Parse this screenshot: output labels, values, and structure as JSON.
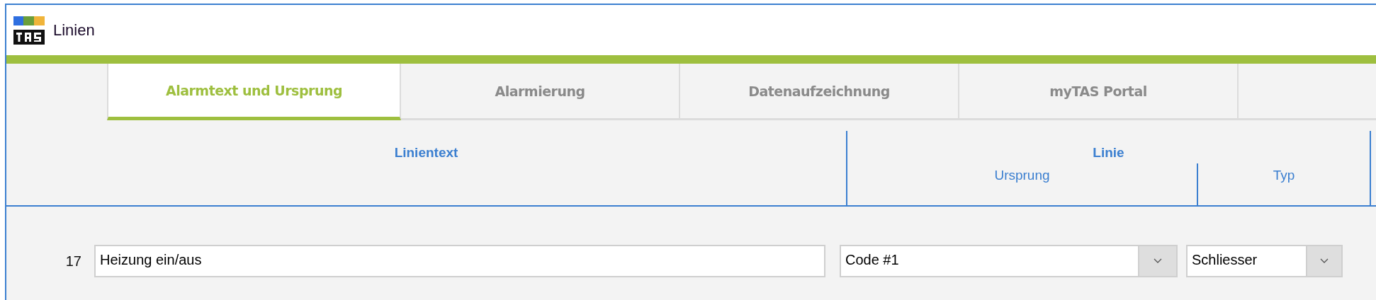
{
  "window": {
    "title": "Linien"
  },
  "tabs": [
    {
      "label": "Alarmtext und Ursprung",
      "selected": true
    },
    {
      "label": "Alarmierung",
      "selected": false
    },
    {
      "label": "Datenaufzeichnung",
      "selected": false
    },
    {
      "label": "myTAS Portal",
      "selected": false
    }
  ],
  "table": {
    "columns": [
      {
        "label": "Linientext"
      },
      {
        "label": "Linie",
        "children": [
          {
            "label": "Ursprung"
          },
          {
            "label": "Typ"
          }
        ]
      }
    ],
    "rows": [
      {
        "number": "17",
        "text": "Heizung ein/aus",
        "origin": "Code #1",
        "type": "Schliesser"
      }
    ]
  }
}
